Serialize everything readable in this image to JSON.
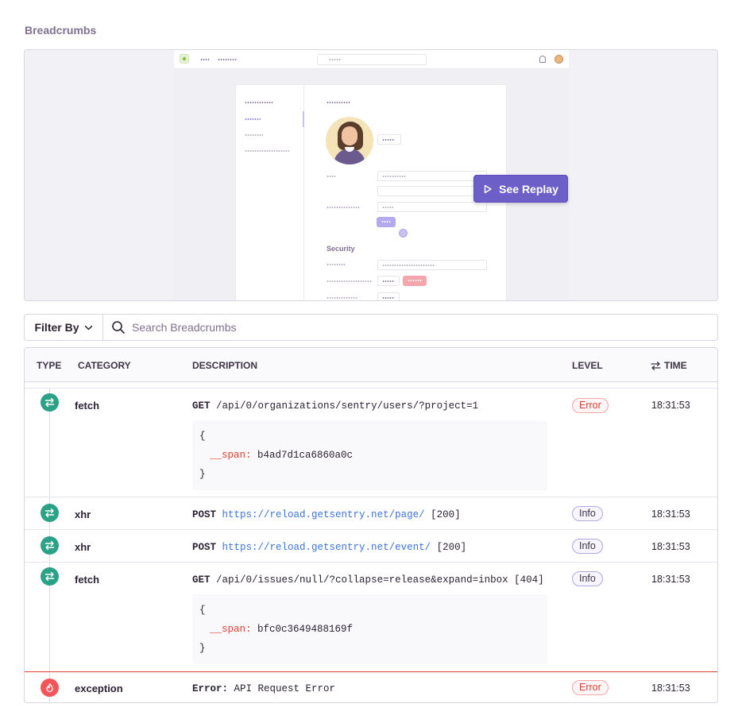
{
  "section": {
    "title": "Breadcrumbs"
  },
  "replay": {
    "security_label": "Security",
    "button_label": "See Replay"
  },
  "filter": {
    "filter_by_label": "Filter By",
    "search_placeholder": "Search Breadcrumbs"
  },
  "table": {
    "headers": {
      "type": "Type",
      "category": "Category",
      "description": "Description",
      "level": "Level",
      "time": "Time"
    },
    "rows": [
      {
        "type_icon": "exchange-arrows-icon",
        "category": "fetch",
        "method": "GET",
        "url": "/api/0/organizations/sentry/users/?project=1",
        "status": "",
        "code": {
          "open": "{",
          "key": "__span:",
          "value": "b4ad7d1ca6860a0c",
          "close": "}"
        },
        "level": "Error",
        "time": "18:31:53"
      },
      {
        "type_icon": "exchange-arrows-icon",
        "category": "xhr",
        "method": "POST",
        "url": "https://reload.getsentry.net/page/",
        "status": "[200]",
        "level": "Info",
        "time": "18:31:53"
      },
      {
        "type_icon": "exchange-arrows-icon",
        "category": "xhr",
        "method": "POST",
        "url": "https://reload.getsentry.net/event/",
        "status": "[200]",
        "level": "Info",
        "time": "18:31:53"
      },
      {
        "type_icon": "exchange-arrows-icon",
        "category": "fetch",
        "method": "GET",
        "url": "/api/0/issues/null/?collapse=release&expand=inbox",
        "status": "[404]",
        "code": {
          "open": "{",
          "key": "__span:",
          "value": "bfc0c3649488169f",
          "close": "}"
        },
        "level": "Info",
        "time": "18:31:53"
      },
      {
        "type_icon": "fire-icon",
        "category": "exception",
        "method": "Error:",
        "url": "API Request Error",
        "status": "",
        "level": "Error",
        "time": "18:31:53"
      }
    ]
  },
  "colors": {
    "accent": "#6c5fc7",
    "http_icon": "#2ba185",
    "exception_icon": "#f55459",
    "link": "#3d74db",
    "error": "#e03e2f"
  }
}
